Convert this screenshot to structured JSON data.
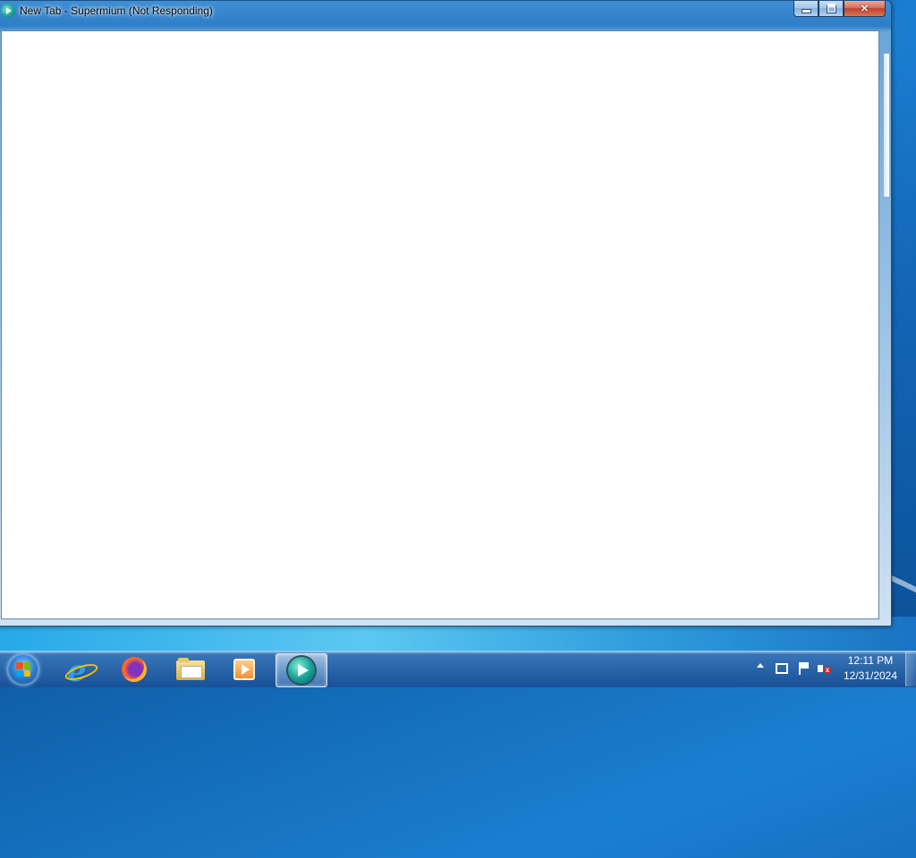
{
  "window": {
    "title": "New Tab - Supermium (Not Responding)",
    "caption_buttons": {
      "minimize": "minimize",
      "maximize": "maximize",
      "close": "✕"
    }
  },
  "taskbar": {
    "start_button": "start-orb",
    "pinned": [
      {
        "name": "internet-explorer-icon"
      },
      {
        "name": "firefox-icon"
      },
      {
        "name": "file-explorer-icon"
      },
      {
        "name": "media-player-icon"
      },
      {
        "name": "supermium-icon",
        "active": true
      }
    ],
    "tray": {
      "icons": [
        "show-hidden-icons",
        "network-icon",
        "action-center-flag-icon",
        "volume-muted-icon"
      ],
      "time": "12:11 PM",
      "date": "12/31/2024"
    }
  },
  "colors": {
    "accent": "#1466b8",
    "close_button": "#c0432b",
    "client_background": "#ffffff"
  }
}
